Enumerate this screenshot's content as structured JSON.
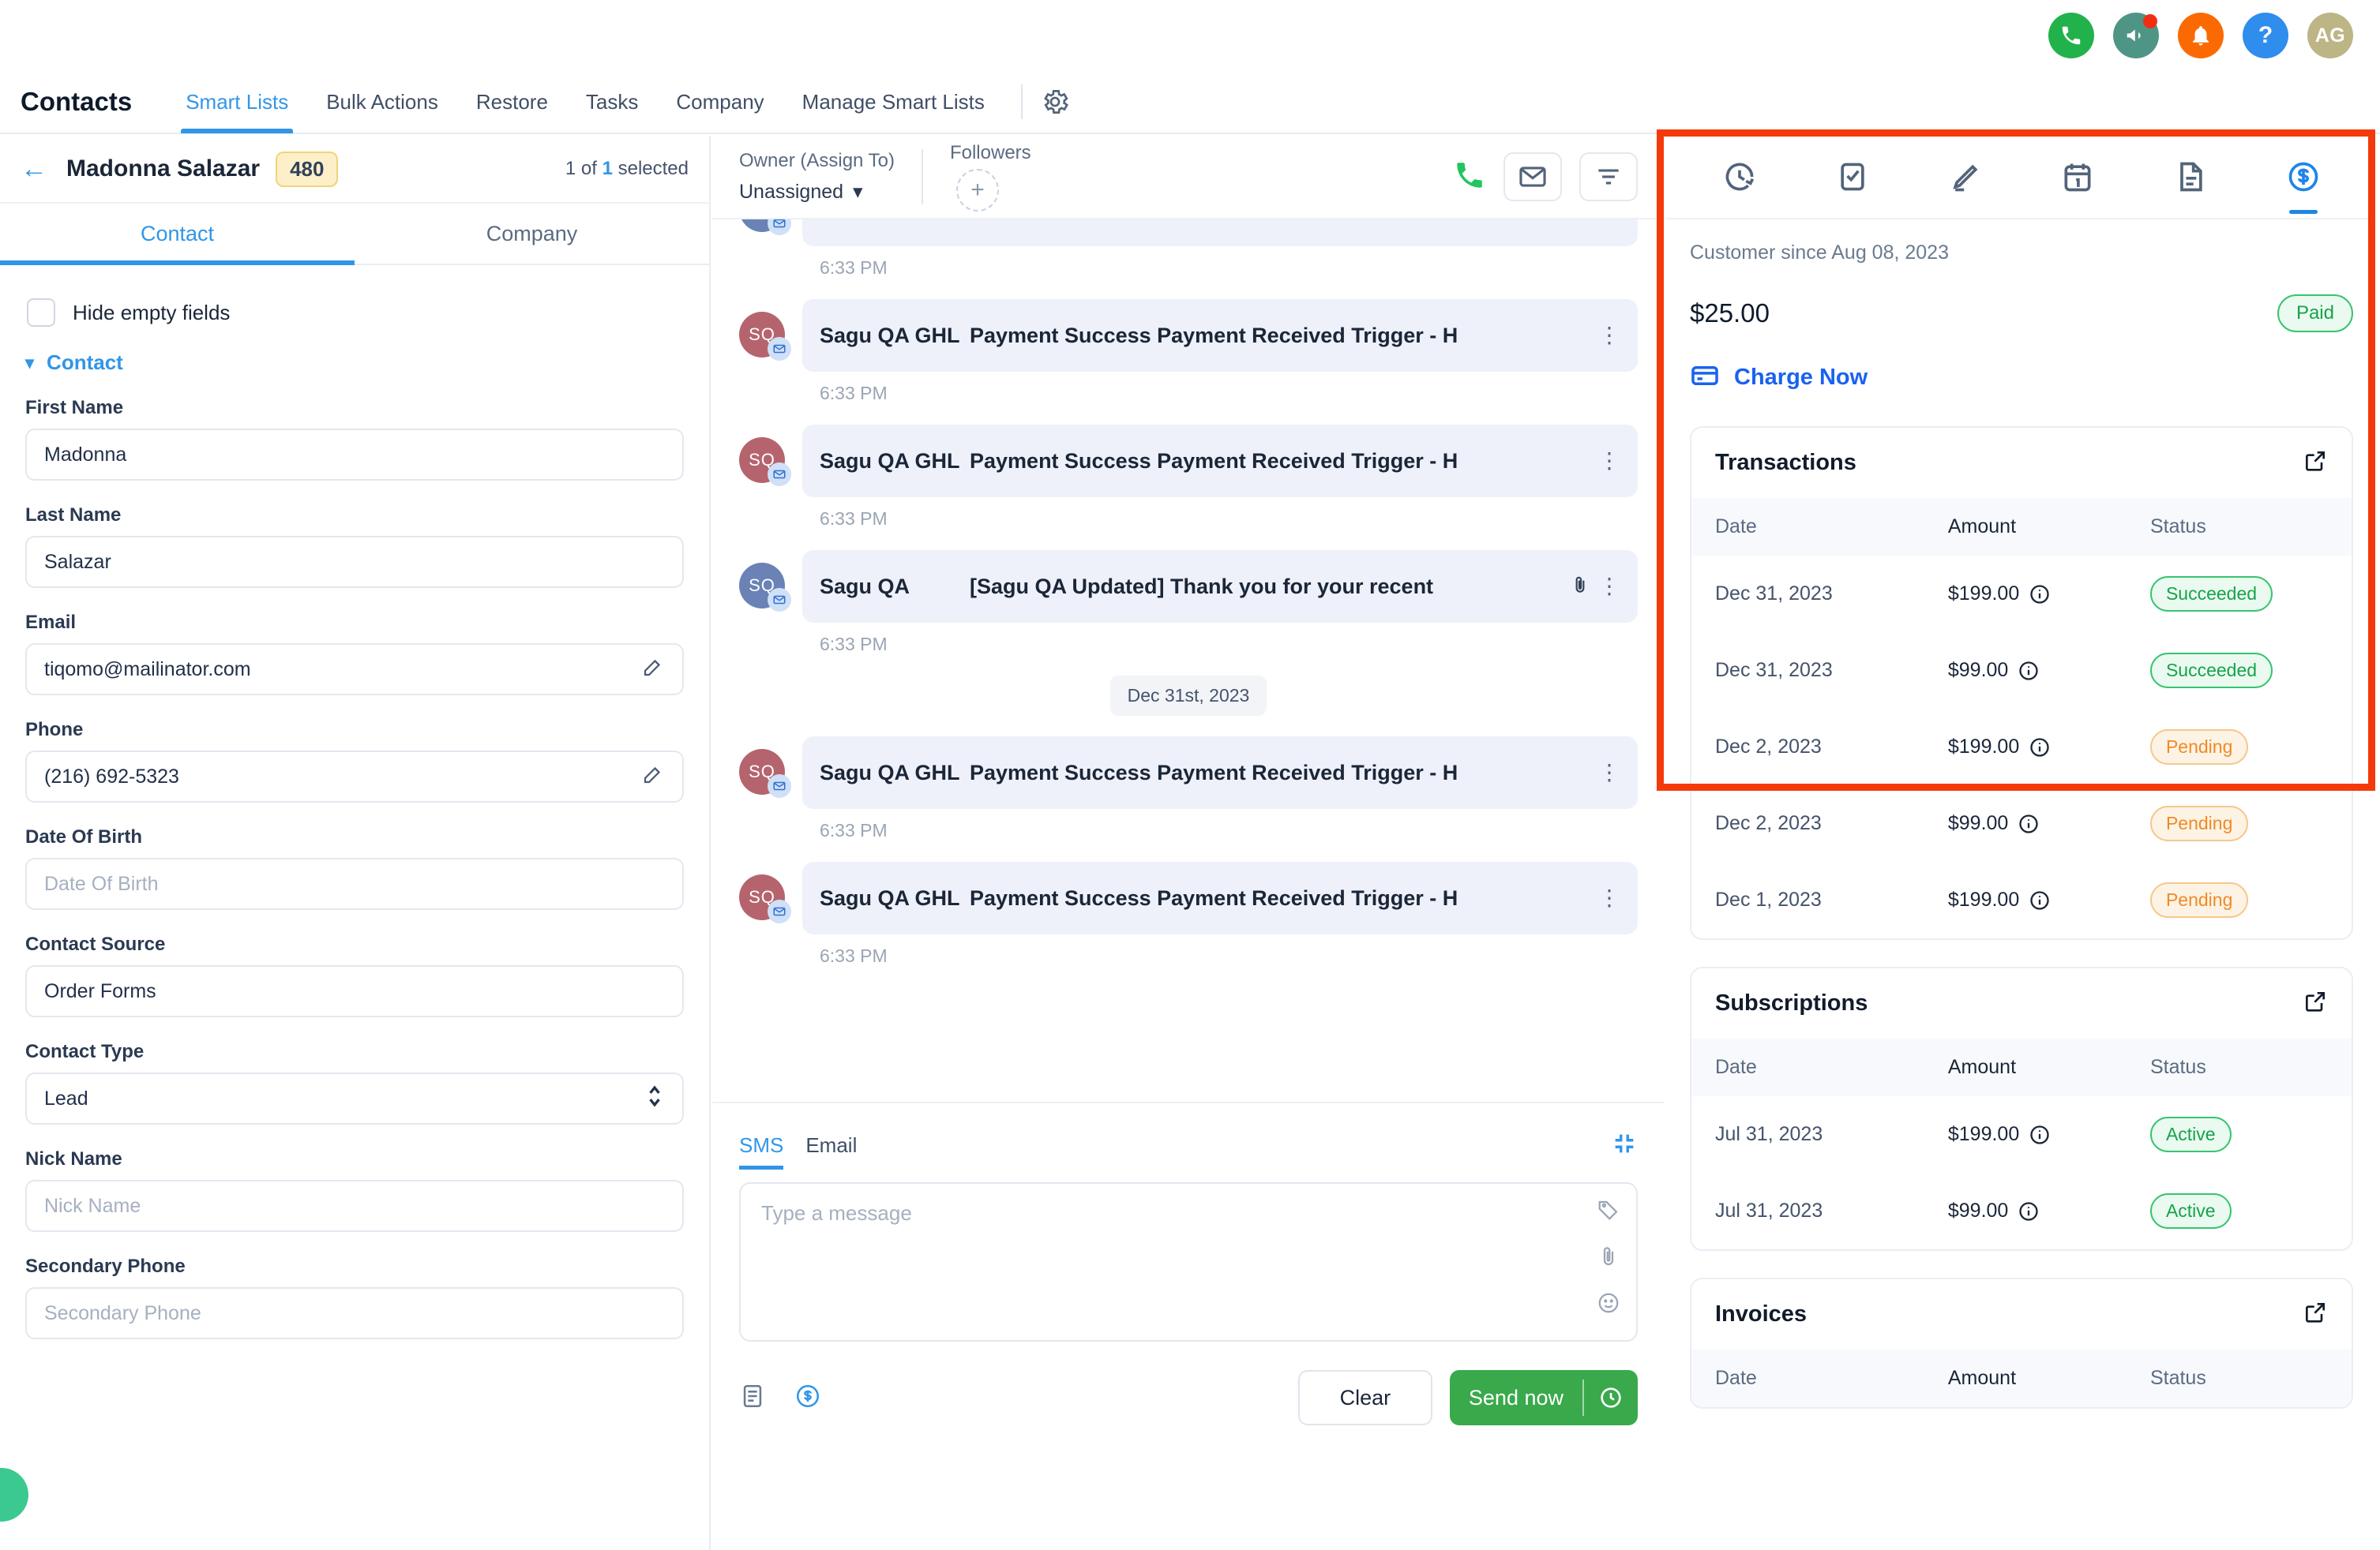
{
  "topbar": {
    "icons": [
      {
        "name": "phone-icon",
        "color": "#22b24c"
      },
      {
        "name": "megaphone-icon",
        "color": "#4f9585",
        "has_badge": true
      },
      {
        "name": "bell-icon",
        "color": "#fb6a02"
      },
      {
        "name": "help-icon",
        "color": "#2f8ded",
        "glyph": "?"
      },
      {
        "name": "avatar",
        "color": "#bdb586",
        "initials": "AG"
      }
    ]
  },
  "nav": {
    "title": "Contacts",
    "items": [
      {
        "label": "Smart Lists",
        "active": true
      },
      {
        "label": "Bulk Actions",
        "active": false
      },
      {
        "label": "Restore",
        "active": false
      },
      {
        "label": "Tasks",
        "active": false
      },
      {
        "label": "Company",
        "active": false
      },
      {
        "label": "Manage Smart Lists",
        "active": false
      }
    ],
    "settings_icon": "gear-icon"
  },
  "left_panel": {
    "contact_name": "Madonna Salazar",
    "count_chip": "480",
    "selected_prefix": "1 of",
    "selected_count": "1",
    "selected_suffix": "selected",
    "tabs": [
      {
        "label": "Contact",
        "active": true
      },
      {
        "label": "Company",
        "active": false
      }
    ],
    "hide_empty_label": "Hide empty fields",
    "section_label": "Contact",
    "fields": [
      {
        "label": "First Name",
        "value": "Madonna",
        "placeholder": "First Name",
        "empty": false,
        "edit": false,
        "type": "text"
      },
      {
        "label": "Last Name",
        "value": "Salazar",
        "placeholder": "Last Name",
        "empty": false,
        "edit": false,
        "type": "text"
      },
      {
        "label": "Email",
        "value": "tiqomo@mailinator.com",
        "placeholder": "Email",
        "empty": false,
        "edit": true,
        "type": "text"
      },
      {
        "label": "Phone",
        "value": "(216) 692-5323",
        "placeholder": "Phone",
        "empty": false,
        "edit": true,
        "type": "text"
      },
      {
        "label": "Date Of Birth",
        "value": "Date Of Birth",
        "placeholder": "Date Of Birth",
        "empty": true,
        "edit": false,
        "type": "text"
      },
      {
        "label": "Contact Source",
        "value": "Order Forms",
        "placeholder": "Contact Source",
        "empty": false,
        "edit": false,
        "type": "text"
      },
      {
        "label": "Contact Type",
        "value": "Lead",
        "placeholder": "Contact Type",
        "empty": false,
        "edit": false,
        "type": "select"
      },
      {
        "label": "Nick Name",
        "value": "Nick Name",
        "placeholder": "Nick Name",
        "empty": true,
        "edit": false,
        "type": "text"
      },
      {
        "label": "Secondary Phone",
        "value": "Secondary Phone",
        "placeholder": "Secondary Phone",
        "empty": true,
        "edit": false,
        "type": "text"
      }
    ]
  },
  "center_panel": {
    "owner_label": "Owner (Assign To)",
    "owner_value": "Unassigned",
    "followers_label": "Followers",
    "followers_add": "+",
    "actions": [
      "call-icon",
      "email-icon",
      "filter-icon"
    ],
    "messages": [
      {
        "sender": "",
        "subject": "",
        "time": "6:33 PM",
        "avatar": "SQ",
        "avatar_color": "red",
        "partial": true,
        "attachment": false
      },
      {
        "sender": "Sagu QA GHL",
        "subject": "Payment Success Payment Received Trigger  -  H",
        "time": "6:33 PM",
        "avatar": "SQ",
        "avatar_color": "red",
        "partial": false,
        "attachment": false
      },
      {
        "sender": "Sagu QA GHL",
        "subject": "Payment Success Payment Received Trigger  -  H",
        "time": "6:33 PM",
        "avatar": "SQ",
        "avatar_color": "red",
        "partial": false,
        "attachment": false
      },
      {
        "sender": "Sagu QA",
        "subject": "[Sagu QA Updated] Thank you for your recent",
        "time": "6:33 PM",
        "avatar": "SQ",
        "avatar_color": "blue",
        "partial": false,
        "attachment": true
      }
    ],
    "date_divider": "Dec 31st, 2023",
    "messages_after": [
      {
        "sender": "Sagu QA GHL",
        "subject": "Payment Success Payment Received Trigger  -  H",
        "time": "6:33 PM",
        "avatar": "SQ",
        "avatar_color": "red",
        "attachment": false
      },
      {
        "sender": "Sagu QA GHL",
        "subject": "Payment Success Payment Received Trigger  -  H",
        "time": "6:33 PM",
        "avatar": "SQ",
        "avatar_color": "red",
        "attachment": false
      }
    ],
    "composer": {
      "tabs": [
        {
          "label": "SMS",
          "active": true
        },
        {
          "label": "Email",
          "active": false
        }
      ],
      "placeholder": "Type a message",
      "clear_label": "Clear",
      "send_label": "Send now",
      "side_icons": [
        "tag-icon",
        "attachment-icon",
        "emoji-icon"
      ],
      "foot_icons": [
        "template-icon",
        "payment-icon"
      ],
      "expand_icon": "collapse-icon",
      "schedule_icon": "clock-icon"
    }
  },
  "right_panel": {
    "tabs": [
      {
        "name": "activity-icon",
        "active": false
      },
      {
        "name": "tasks-icon",
        "active": false
      },
      {
        "name": "notes-icon",
        "active": false
      },
      {
        "name": "appointments-icon",
        "active": false
      },
      {
        "name": "documents-icon",
        "active": false
      },
      {
        "name": "payments-icon",
        "active": true
      }
    ],
    "customer_since": "Customer since Aug 08, 2023",
    "amount": "$25.00",
    "amount_badge": "Paid",
    "charge_now_label": "Charge Now",
    "columns": [
      "Date",
      "Amount",
      "Status"
    ],
    "sections": [
      {
        "title": "Transactions",
        "rows": [
          {
            "date": "Dec 31, 2023",
            "amount": "$199.00",
            "status": "Succeeded",
            "status_type": "succeeded"
          },
          {
            "date": "Dec 31, 2023",
            "amount": "$99.00",
            "status": "Succeeded",
            "status_type": "succeeded"
          },
          {
            "date": "Dec 2, 2023",
            "amount": "$199.00",
            "status": "Pending",
            "status_type": "pending"
          },
          {
            "date": "Dec 2, 2023",
            "amount": "$99.00",
            "status": "Pending",
            "status_type": "pending"
          },
          {
            "date": "Dec 1, 2023",
            "amount": "$199.00",
            "status": "Pending",
            "status_type": "pending"
          }
        ]
      },
      {
        "title": "Subscriptions",
        "rows": [
          {
            "date": "Jul 31, 2023",
            "amount": "$199.00",
            "status": "Active",
            "status_type": "active"
          },
          {
            "date": "Jul 31, 2023",
            "amount": "$99.00",
            "status": "Active",
            "status_type": "active"
          }
        ]
      },
      {
        "title": "Invoices",
        "rows": []
      }
    ]
  },
  "annotation": {
    "color": "#f43a0c",
    "shape": "rectangle"
  }
}
